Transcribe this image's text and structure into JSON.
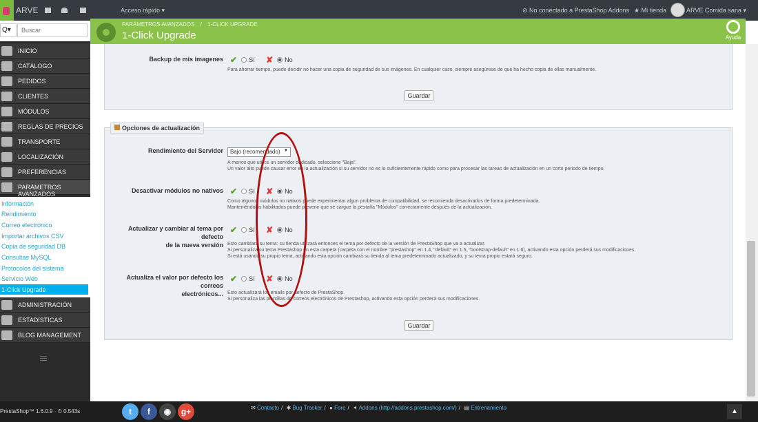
{
  "topbar": {
    "shop_name": "ARVE",
    "quick_access": "Acceso rápido ▾",
    "addons_status": "No conectado a PrestaShop Addons",
    "my_shop": "Mi tienda",
    "user": "ARVE Comida sana ▾"
  },
  "search": {
    "button": "Q▾",
    "placeholder": "Buscar"
  },
  "sidebar": {
    "items": [
      {
        "label": "Inicio"
      },
      {
        "label": "Catálogo"
      },
      {
        "label": "Pedidos"
      },
      {
        "label": "Clientes"
      },
      {
        "label": "Módulos"
      },
      {
        "label": "Reglas de precios"
      },
      {
        "label": "Transporte"
      },
      {
        "label": "Localización"
      },
      {
        "label": "Preferencias"
      },
      {
        "label": "Parámetros avanzados"
      },
      {
        "label": "Administración"
      },
      {
        "label": "Estadísticas"
      },
      {
        "label": "Blog Management"
      }
    ],
    "submenu": [
      "Información",
      "Rendimiento",
      "Correo electrónico",
      "Importar archivos CSV",
      "Copia de seguridad DB",
      "Consultas MySQL",
      "Protocolos del sistema",
      "Servicio Web",
      "1-Click Upgrade"
    ]
  },
  "header": {
    "breadcrumb_parent": "PARÁMETROS AVANZADOS",
    "breadcrumb_sep": "/",
    "breadcrumb_current": "1-CLICK UPGRADE",
    "title": "1-Click Upgrade",
    "help": "Ayuda"
  },
  "panel1": {
    "backup_label": "Backup de mis imagenes",
    "yes": "Sí",
    "no": "No",
    "help": "Para ahorrar tiempo, puede decidir no hacer una copia de seguridad de sus imágenes. En cualquier caso, siempre asegúrese de que ha hecho copia de ellas manualmente.",
    "save": "Guardar"
  },
  "panel2": {
    "legend": "Opciones de actualización",
    "performance_label": "Rendimiento del Servidor",
    "performance_value": "Bajo (recomendado)",
    "performance_help1": "A menos que utilice un servidor dedicado, seleccione \"Baja\".",
    "performance_help2": "Un valor alto puede causar error en la actualización si su servidor no es lo suficientemente rápido como para procesar las tareas de actualización en un corto periodo de tiempo.",
    "modules_label": "Desactivar módulos no nativos",
    "modules_help1": "Como algunos módulos no nativos puede experimentar algun problema de compatibilidad, se recomienda desactivarlos de forma predeterminada.",
    "modules_help2": "Manteniéndolos habilitados puede prevenir que se cargue la pestaña \"Módulos\" correctamente después de la actualización.",
    "theme_label1": "Actualizar y cambiar al tema por defecto",
    "theme_label2": "de la nueva versión",
    "theme_help1": "Esto cambiará su tema: su tienda utilizará entonces el tema por defecto de la versión de PrestaShop que va a actualizar.",
    "theme_help2": "Si personaliza su tema Prestashop en esta carpeta (carpeta con el nombre \"prestashop\" en 1.4, \"default\" en 1.5, \"bootstrap-default\" en 1.6), activando esta opción perderá sus modificaciones.",
    "theme_help3": "Si está usando su propio tema, activando esta opción cambiará su tienda al tema predeterminado actualizado, y su tema propio estará seguro.",
    "emails_label1": "Actualiza el valor por defecto los correos",
    "emails_label2": "electrónicos...",
    "emails_help1": "Esto actualizará los emails por defecto de PrestaShop.",
    "emails_help2": "Si personaliza las plantillas de correos electrónicos de Prestashop, activando esta opción perderá sus modificaciones.",
    "yes": "Sí",
    "no": "No",
    "save": "Guardar"
  },
  "footer": {
    "version": "PrestaShop™ 1.6.0.9 · ⏱ 0.543s",
    "social": {
      "twitter": "t",
      "facebook": "f",
      "github": "◉",
      "gplus": "g+"
    },
    "links": {
      "contact": "Contacto",
      "bug_tracker": "Bug Tracker",
      "forum": "Foro",
      "addons": "Addons (http://addons.prestashop.com/)",
      "training": "Entrenamiento",
      "sep": "/"
    },
    "to_top": "▲"
  },
  "colors": {
    "accent_green": "#8bc34a",
    "active_blue": "#00aff0",
    "annotation_red": "#b01010"
  },
  "icons": [
    "cart-icon",
    "user-icon",
    "mail-icon",
    "plug-icon",
    "star-icon",
    "gear-icon",
    "help-icon",
    "check-icon",
    "cross-icon",
    "wrench-icon",
    "twitter-icon",
    "facebook-icon",
    "github-icon",
    "gplus-icon"
  ]
}
